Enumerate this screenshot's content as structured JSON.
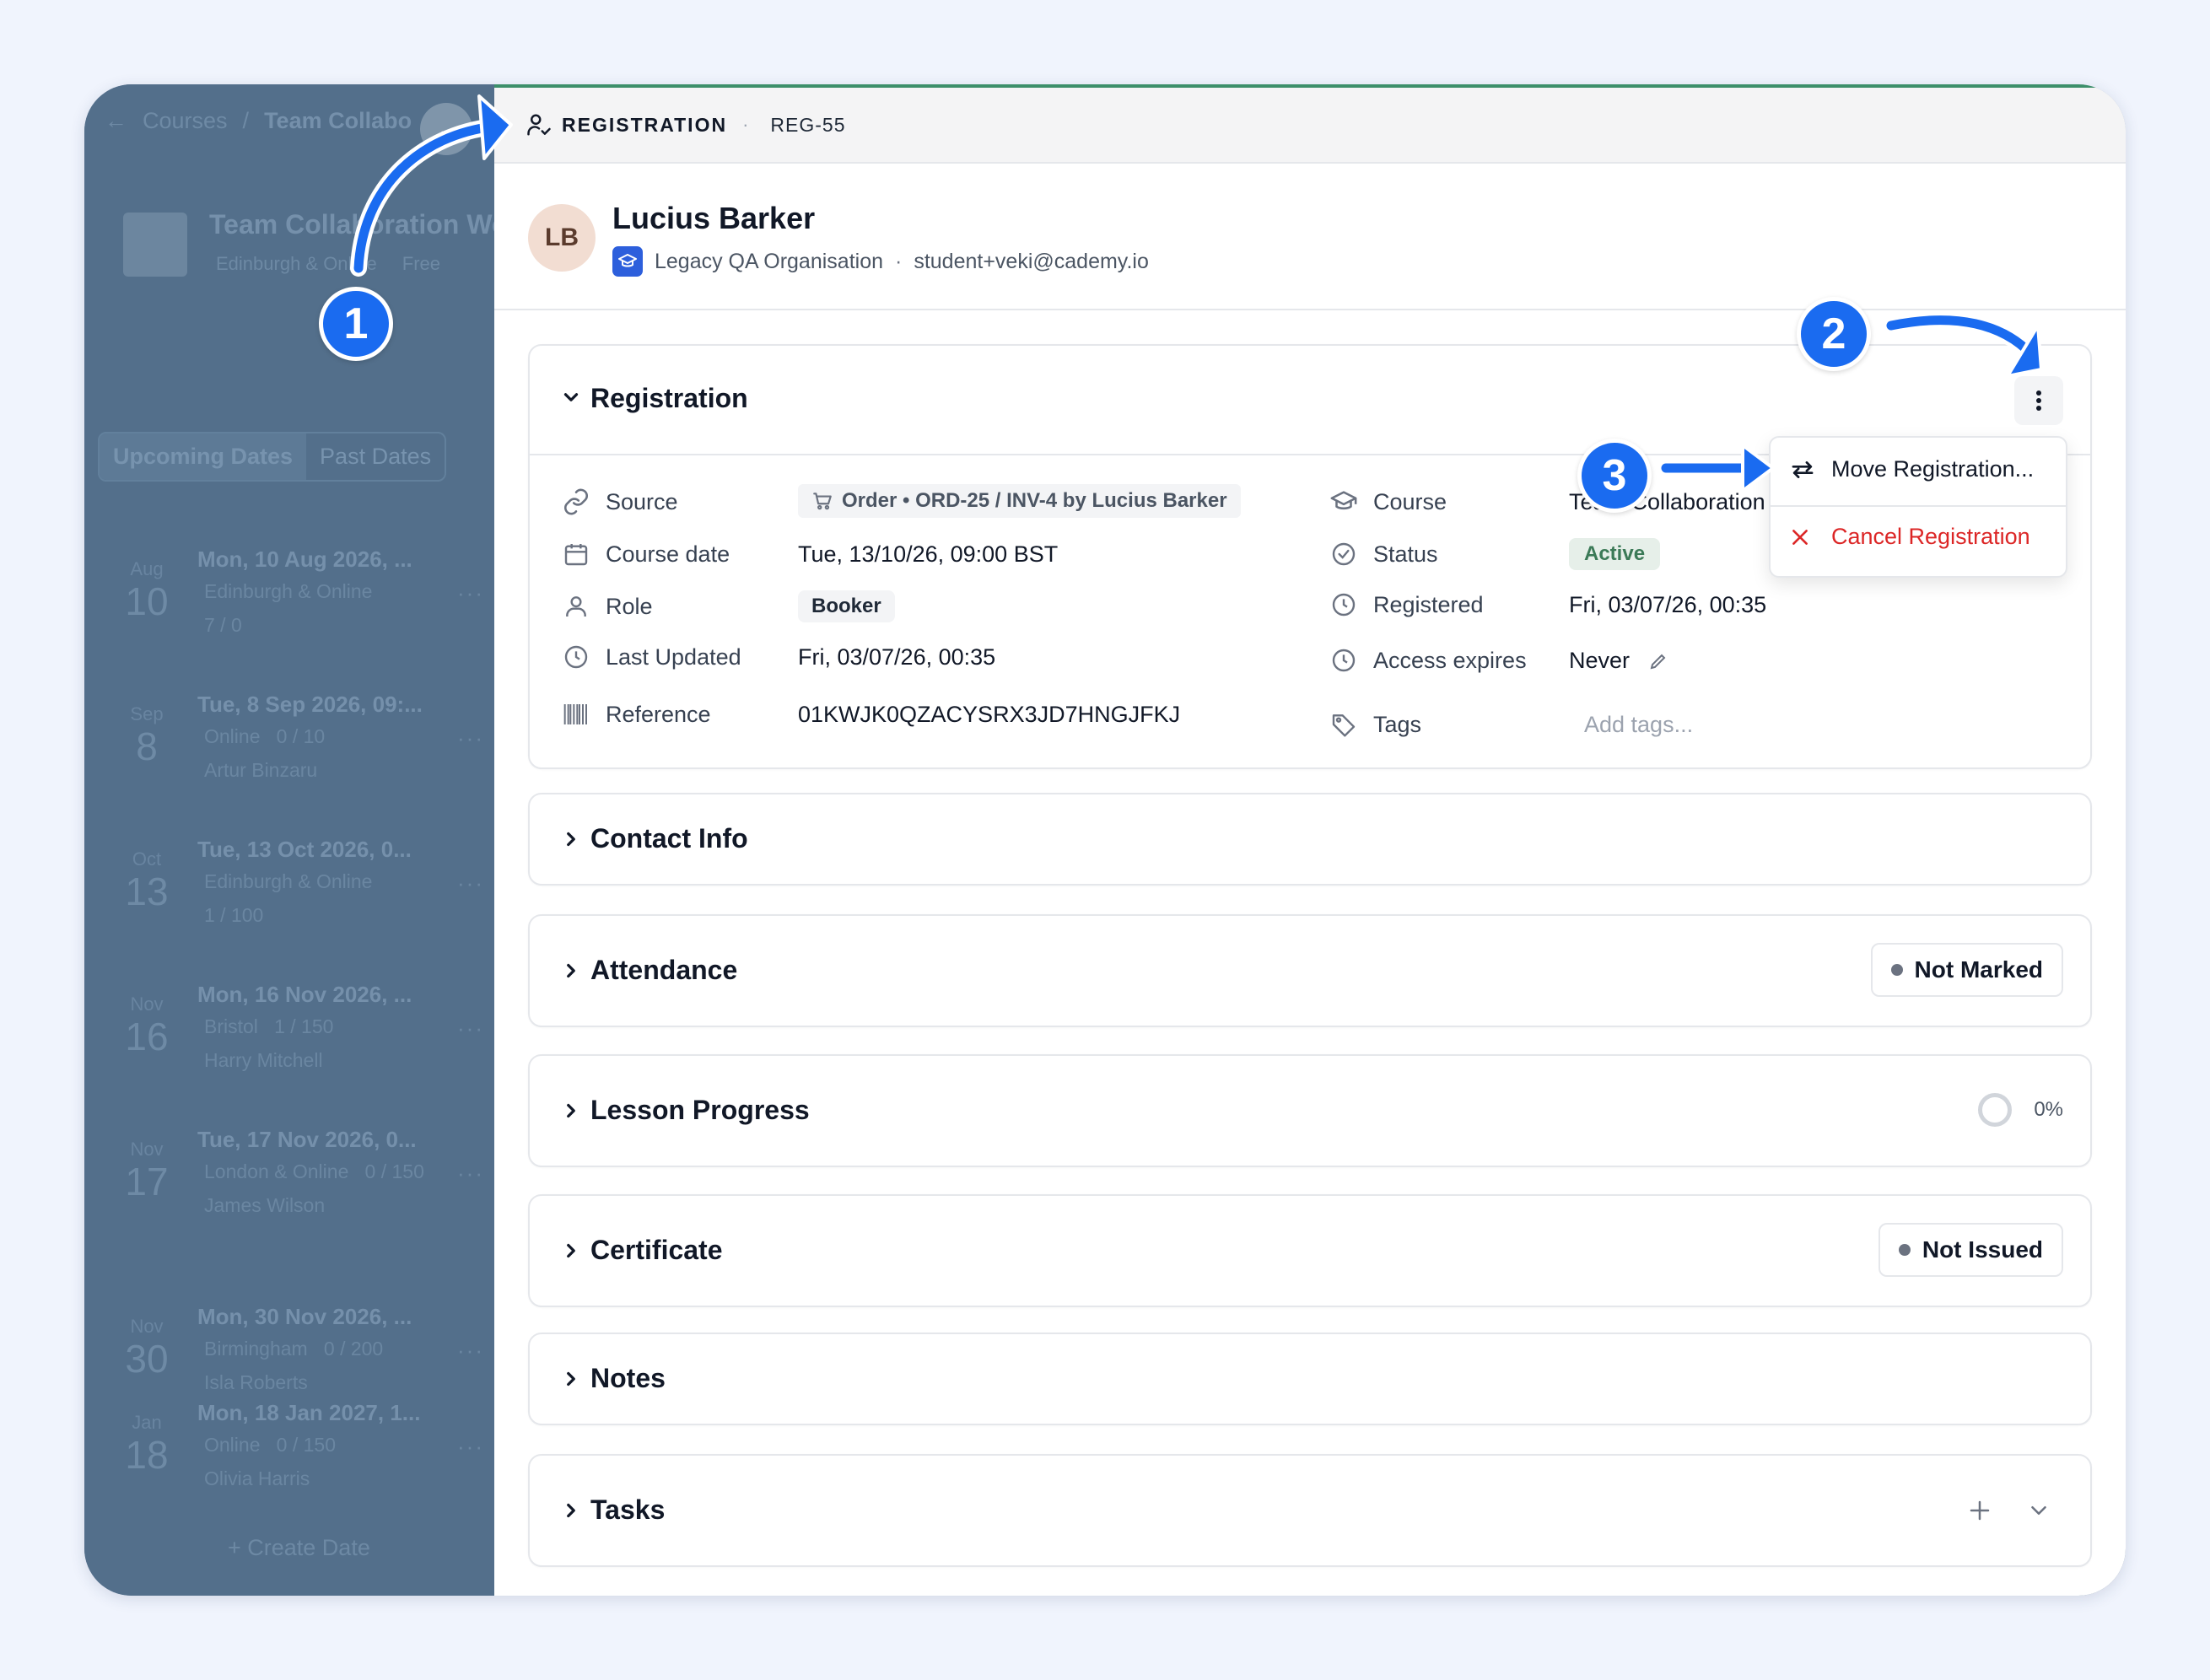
{
  "background_page": {
    "breadcrumb": [
      "Courses",
      "Team Collabo"
    ],
    "course_title": "Team Collaboration Wo",
    "course_meta": [
      "Edinburgh & Online",
      "Free"
    ],
    "tabs": [
      "Upcoming Dates",
      "Past Dates"
    ],
    "dates": [
      {
        "month": "Aug",
        "day": "10",
        "title": "Mon, 10 Aug 2026, ...",
        "location": "Edinburgh & Online",
        "detail": "7 / 0"
      },
      {
        "month": "Sep",
        "day": "8",
        "title": "Tue, 8 Sep 2026, 09:...",
        "location": "Online",
        "detail": "0 / 10",
        "trainer": "Artur Binzaru"
      },
      {
        "month": "Oct",
        "day": "13",
        "title": "Tue, 13 Oct 2026, 0...",
        "location": "Edinburgh & Online",
        "detail": "1 / 100"
      },
      {
        "month": "Nov",
        "day": "16",
        "title": "Mon, 16 Nov 2026, ...",
        "location": "Bristol",
        "detail": "1 / 150",
        "trainer": "Harry Mitchell"
      },
      {
        "month": "Nov",
        "day": "17",
        "title": "Tue, 17 Nov 2026, 0...",
        "location": "London & Online",
        "detail": "0 / 150",
        "trainer": "James Wilson"
      },
      {
        "month": "Nov",
        "day": "30",
        "title": "Mon, 30 Nov 2026, ...",
        "location": "Birmingham",
        "detail": "0 / 200",
        "trainer": "Isla Roberts"
      },
      {
        "month": "Jan",
        "day": "18",
        "title": "Mon, 18 Jan 2027, 1...",
        "location": "Online",
        "detail": "0 / 150",
        "trainer": "Olivia Harris"
      }
    ],
    "create_label": "+ Create Date"
  },
  "drawer": {
    "kind": "REGISTRATION",
    "separator": "·",
    "code": "REG-55",
    "person": {
      "initials": "LB",
      "name": "Lucius Barker",
      "organisation": "Legacy QA Organisation",
      "separator": "·",
      "email": "student+veki@cademy.io"
    }
  },
  "registration": {
    "title": "Registration",
    "left": {
      "source_label": "Source",
      "source_value": "Order • ORD-25 / INV-4 by Lucius Barker",
      "course_date_label": "Course date",
      "course_date_value": "Tue, 13/10/26, 09:00 BST",
      "role_label": "Role",
      "role_value": "Booker",
      "last_updated_label": "Last Updated",
      "last_updated_value": "Fri, 03/07/26, 00:35",
      "reference_label": "Reference",
      "reference_value": "01KWJK0QZACYSRX3JD7HNGJFKJ"
    },
    "right": {
      "course_label": "Course",
      "course_value": "Team Collaboration",
      "status_label": "Status",
      "status_value": "Active",
      "registered_label": "Registered",
      "registered_value": "Fri, 03/07/26, 00:35",
      "access_label": "Access expires",
      "access_value": "Never",
      "tags_label": "Tags",
      "tags_placeholder": "Add tags..."
    }
  },
  "menu": {
    "move_label": "Move Registration...",
    "cancel_label": "Cancel Registration"
  },
  "sections": {
    "contact": "Contact Info",
    "attendance": "Attendance",
    "attendance_status": "Not Marked",
    "lesson_progress": "Lesson Progress",
    "lesson_progress_pct": "0%",
    "certificate": "Certificate",
    "certificate_status": "Not Issued",
    "notes": "Notes",
    "tasks": "Tasks"
  },
  "callouts": [
    "1",
    "2",
    "3"
  ],
  "colors": {
    "callout": "#1a6bf0",
    "status_active_bg": "#e6efe9",
    "status_active_text": "#3b7a57",
    "cancel": "#dc2626",
    "top_accent": "#3c8f6a"
  }
}
